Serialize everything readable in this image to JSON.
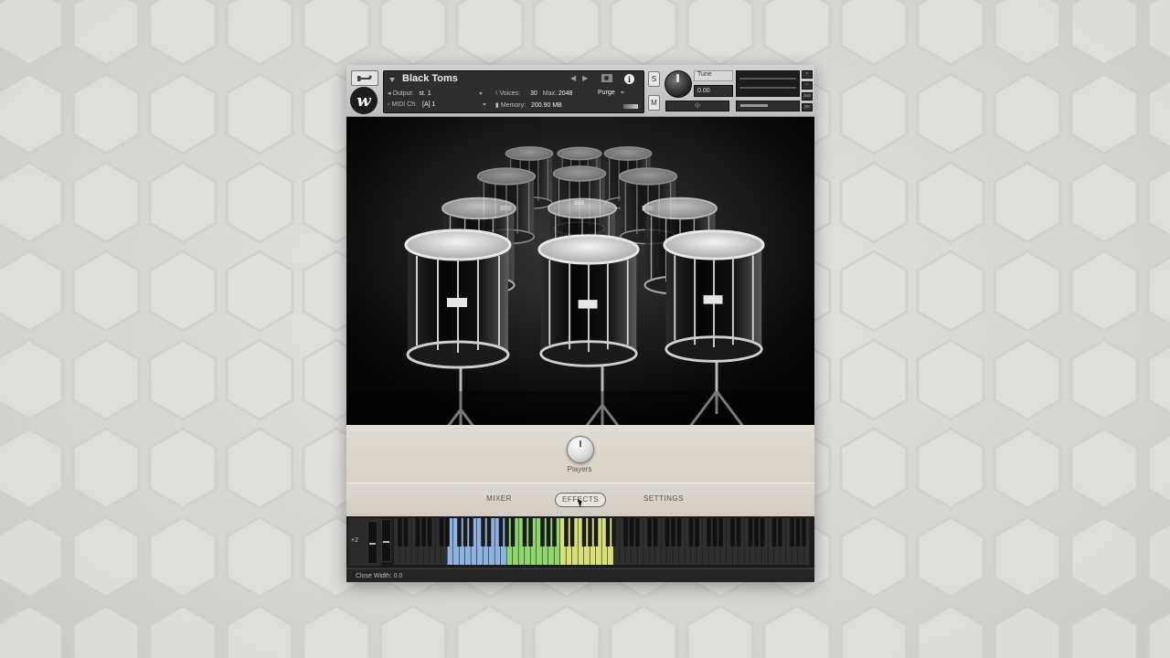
{
  "header": {
    "instrument_name": "Black Toms",
    "output_label": "Output:",
    "output_value": "st. 1",
    "voices_label": "Voices:",
    "voices_value": "30",
    "max_label": "Max:",
    "max_value": "2048",
    "purge_label": "Purge",
    "midi_label": "MIDI Ch:",
    "midi_value": "[A]  1",
    "memory_label": "Memory:",
    "memory_value": "200.90 MB",
    "solo_label": "S",
    "mute_label": "M",
    "tune_label": "Tune",
    "tune_value": "0.00",
    "logo_letter": "w",
    "aux_label": "aux",
    "pv_label": "pv"
  },
  "controls": {
    "players_label": "Players"
  },
  "tabs": [
    {
      "label": "MIXER",
      "active": false
    },
    {
      "label": "EFFECTS",
      "active": true
    },
    {
      "label": "SETTINGS",
      "active": false
    }
  ],
  "keyboard": {
    "octave_shift": "+2",
    "zone_colors": {
      "blue": "#8db3e2",
      "green": "#8fd66e",
      "yellow": "#d9e07a"
    }
  },
  "status": {
    "text": "Close Width: 0.0"
  }
}
